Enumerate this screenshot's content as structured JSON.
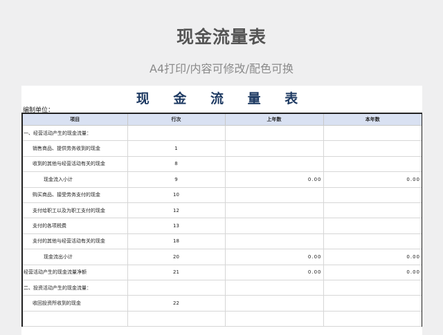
{
  "banner": {
    "title": "现金流量表",
    "subtitle": "A4打印/内容可修改/配色可换"
  },
  "sheet": {
    "title": "现 金 流 量 表",
    "unit_label": "编制单位：",
    "headers": {
      "item": "项目",
      "line": "行次",
      "prev_year": "上年数",
      "this_year": "本年数"
    },
    "rows": [
      {
        "item": "一、经营活动产生的现金流量：",
        "line": "",
        "prev": "",
        "curr": ""
      },
      {
        "item": "销售商品、提供劳务收到的现金",
        "line": "1",
        "prev": "",
        "curr": ""
      },
      {
        "item": "收到的其他与经营活动有关的现金",
        "line": "8",
        "prev": "",
        "curr": ""
      },
      {
        "item": "现金流入小计",
        "line": "9",
        "prev": "0.00",
        "curr": "0.00"
      },
      {
        "item": "购买商品、接受劳务支付的现金",
        "line": "10",
        "prev": "",
        "curr": ""
      },
      {
        "item": "支付给职工以及为职工支付的现金",
        "line": "12",
        "prev": "",
        "curr": ""
      },
      {
        "item": "支付的各项税费",
        "line": "13",
        "prev": "",
        "curr": ""
      },
      {
        "item": "支付的其他与经营活动有关的现金",
        "line": "18",
        "prev": "",
        "curr": ""
      },
      {
        "item": "现金流出小计",
        "line": "20",
        "prev": "0.00",
        "curr": "0.00"
      },
      {
        "item": "经营活动产生的现金流量净额",
        "line": "21",
        "prev": "0.00",
        "curr": "0.00"
      },
      {
        "item": "二、投资活动产生的现金流量：",
        "line": "",
        "prev": "",
        "curr": ""
      },
      {
        "item": "收回投资所收到的现金",
        "line": "22",
        "prev": "",
        "curr": ""
      },
      {
        "item": "",
        "line": "",
        "prev": "",
        "curr": ""
      }
    ]
  }
}
